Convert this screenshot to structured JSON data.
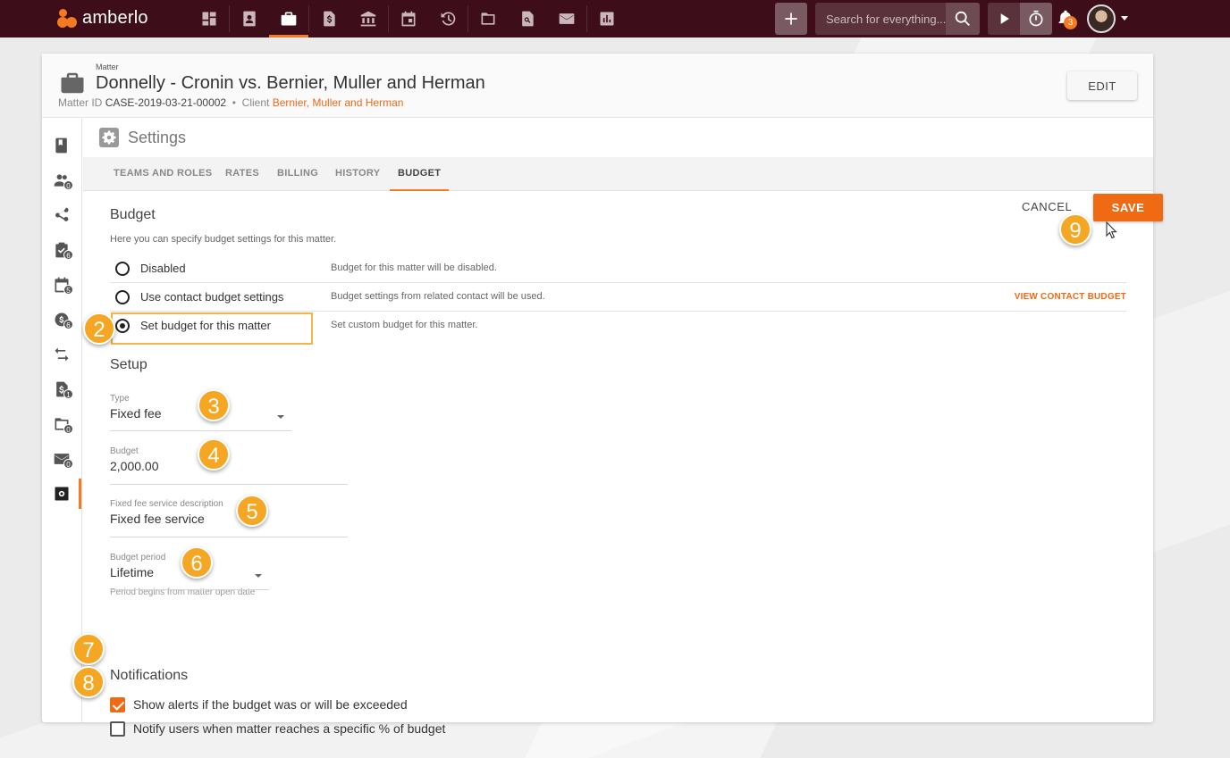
{
  "app": {
    "logo_text": "amberlo",
    "search_placeholder": "Search for everything...",
    "notification_count": "3",
    "nav_icons": [
      "dashboard-icon",
      "contacts-icon",
      "matters-icon",
      "invoices-icon",
      "bank-icon",
      "calendar-icon",
      "time-icon",
      "documents-icon",
      "document-search-icon",
      "mail-icon",
      "reports-icon"
    ],
    "accent_color": "#f06a14",
    "topbar_color": "#3d0e1a"
  },
  "matter": {
    "kicker": "Matter",
    "title": "Donnelly - Cronin vs. Bernier, Muller and Herman",
    "id_label": "Matter ID",
    "id_value": "CASE-2019-03-21-00002",
    "separator": "•",
    "client_label": "Client",
    "client_value": "Bernier, Muller and Herman",
    "edit_label": "EDIT"
  },
  "sidebar": {
    "items": [
      {
        "icon": "book-icon",
        "badge": ""
      },
      {
        "icon": "team-icon",
        "badge": "0"
      },
      {
        "icon": "share-icon",
        "badge": ""
      },
      {
        "icon": "tasks-icon",
        "badge": "6"
      },
      {
        "icon": "calendar-icon",
        "badge": "5"
      },
      {
        "icon": "time-entries-icon",
        "badge": "6"
      },
      {
        "icon": "transfer-icon",
        "badge": ""
      },
      {
        "icon": "invoice-icon",
        "badge": "1"
      },
      {
        "icon": "folder-icon",
        "badge": "0"
      },
      {
        "icon": "mail-icon",
        "badge": "0"
      },
      {
        "icon": "settings-icon",
        "badge": ""
      }
    ]
  },
  "settings": {
    "title": "Settings",
    "tabs": [
      "TEAMS AND ROLES",
      "RATES",
      "BILLING",
      "HISTORY",
      "BUDGET"
    ],
    "active_tab": "BUDGET"
  },
  "budget": {
    "heading": "Budget",
    "subtitle": "Here you can specify budget settings for this matter.",
    "cancel_label": "CANCEL",
    "save_label": "SAVE",
    "options": [
      {
        "label": "Disabled",
        "desc": "Budget for this matter will be disabled.",
        "link": "",
        "checked": false
      },
      {
        "label": "Use contact budget settings",
        "desc": "Budget settings from related contact will be used.",
        "link": "VIEW CONTACT BUDGET",
        "checked": false
      },
      {
        "label": "Set budget for this matter",
        "desc": "Set custom budget for this matter.",
        "link": "",
        "checked": true
      }
    ]
  },
  "setup": {
    "heading": "Setup",
    "type_label": "Type",
    "type_value": "Fixed fee",
    "budget_label": "Budget",
    "budget_value": "2,000.00",
    "service_label": "Fixed fee service description",
    "service_value": "Fixed fee service",
    "period_label": "Budget period",
    "period_value": "Lifetime",
    "period_helper": "Period begins from matter open date"
  },
  "notifications": {
    "heading": "Notifications",
    "alert_label": "Show alerts if the budget was or will be exceeded",
    "alert_checked": true,
    "notify_label": "Notify users when matter reaches a specific % of budget",
    "notify_checked": false
  },
  "steps": [
    "2",
    "3",
    "4",
    "5",
    "6",
    "7",
    "8",
    "9"
  ]
}
